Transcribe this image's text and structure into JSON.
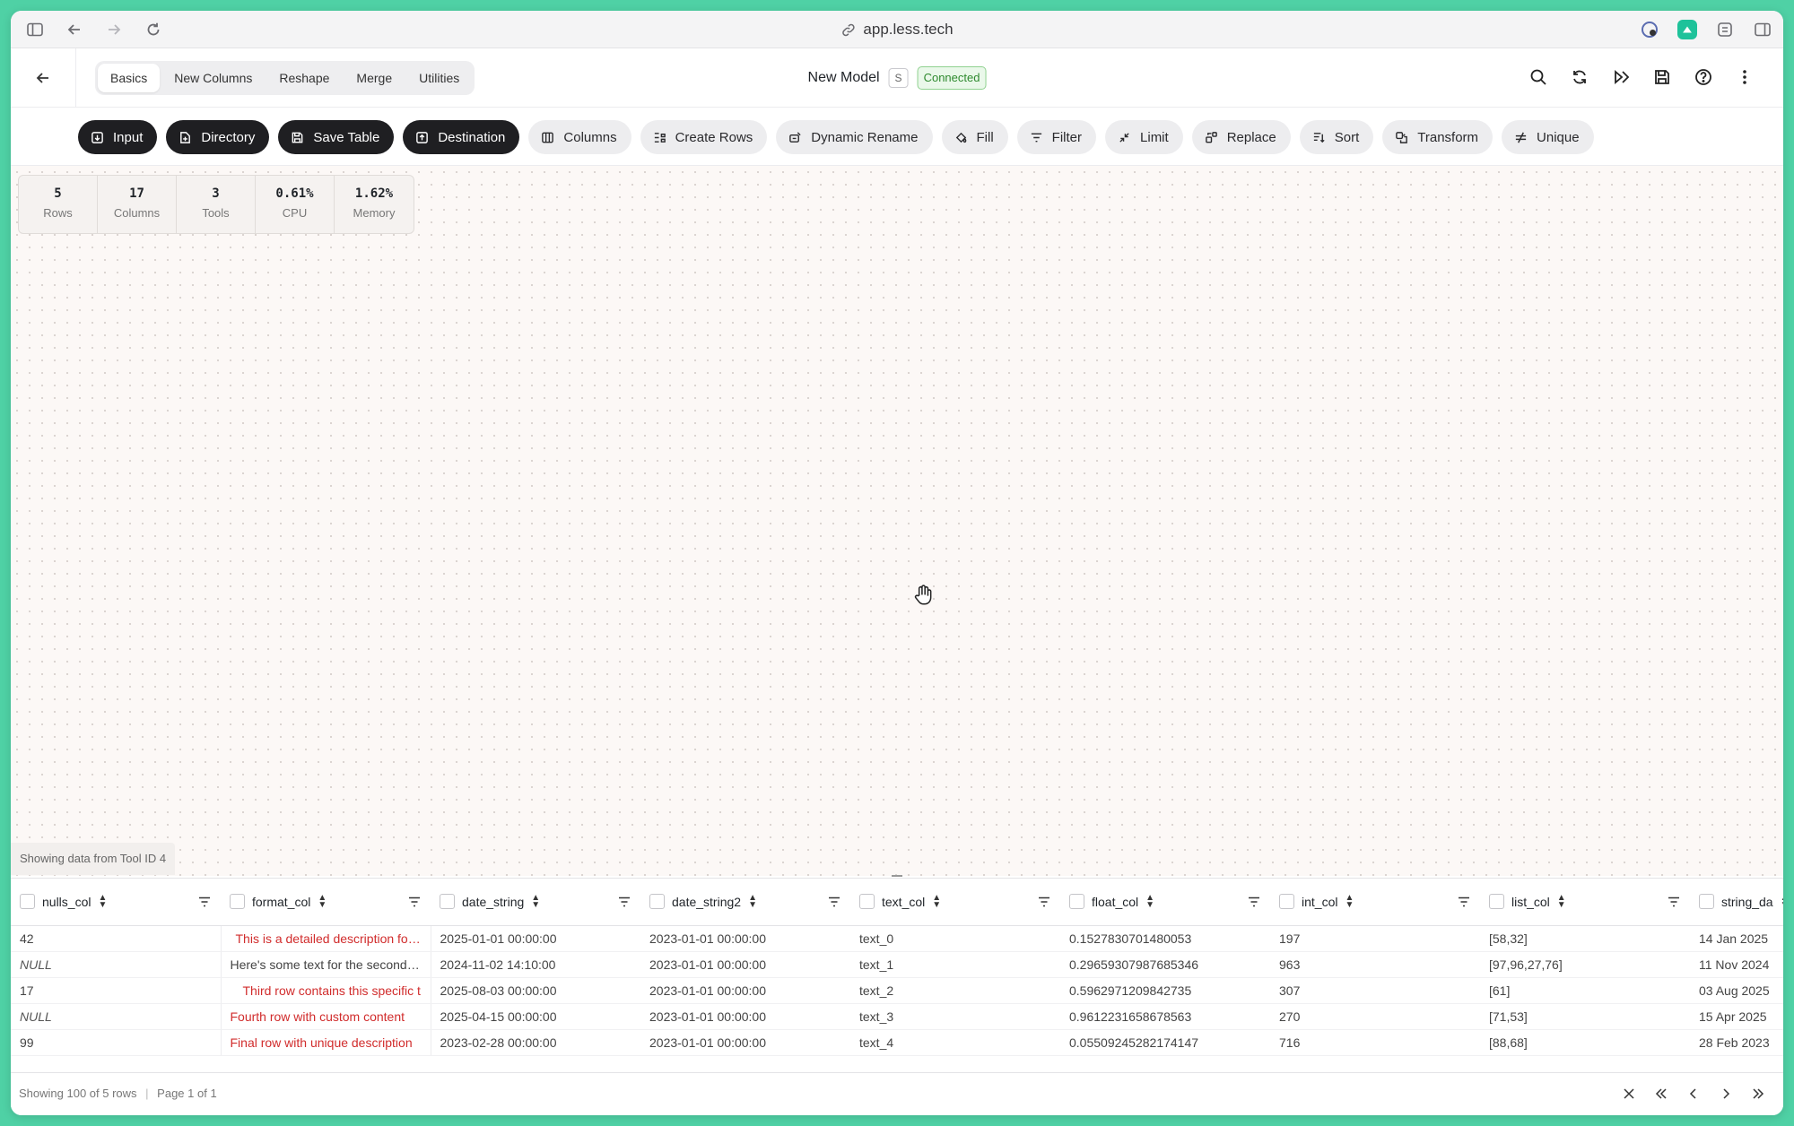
{
  "browser": {
    "url": "app.less.tech"
  },
  "header": {
    "tabs": [
      "Basics",
      "New Columns",
      "Reshape",
      "Merge",
      "Utilities"
    ],
    "model_name": "New Model",
    "model_badge": "S",
    "status": "Connected"
  },
  "toolbar": {
    "tools": [
      {
        "label": "Input",
        "icon": "input-icon",
        "style": "dark"
      },
      {
        "label": "Directory",
        "icon": "directory-icon",
        "style": "dark"
      },
      {
        "label": "Save Table",
        "icon": "save-icon",
        "style": "dark"
      },
      {
        "label": "Destination",
        "icon": "destination-icon",
        "style": "dark"
      },
      {
        "label": "Columns",
        "icon": "columns-icon",
        "style": "light"
      },
      {
        "label": "Create Rows",
        "icon": "create-rows-icon",
        "style": "light"
      },
      {
        "label": "Dynamic Rename",
        "icon": "rename-icon",
        "style": "light"
      },
      {
        "label": "Fill",
        "icon": "fill-icon",
        "style": "light"
      },
      {
        "label": "Filter",
        "icon": "filter-icon",
        "style": "light"
      },
      {
        "label": "Limit",
        "icon": "limit-icon",
        "style": "light"
      },
      {
        "label": "Replace",
        "icon": "replace-icon",
        "style": "light"
      },
      {
        "label": "Sort",
        "icon": "sort-icon",
        "style": "light"
      },
      {
        "label": "Transform",
        "icon": "transform-icon",
        "style": "light"
      },
      {
        "label": "Unique",
        "icon": "unique-icon",
        "style": "light"
      }
    ]
  },
  "stats": [
    {
      "value": "5",
      "label": "Rows"
    },
    {
      "value": "17",
      "label": "Columns"
    },
    {
      "value": "3",
      "label": "Tools"
    },
    {
      "value": "0.61%",
      "label": "CPU"
    },
    {
      "value": "1.62%",
      "label": "Memory"
    }
  ],
  "source_label": "Showing data from Tool ID 4",
  "table": {
    "columns": [
      "nulls_col",
      "format_col",
      "date_string",
      "date_string2",
      "text_col",
      "float_col",
      "int_col",
      "list_col",
      "string_da"
    ],
    "rows": [
      [
        "42",
        "This is a detailed description for ro",
        "2025-01-01 00:00:00",
        "2023-01-01 00:00:00",
        "text_0",
        "0.1527830701480053",
        "197",
        "[58,32]",
        "14 Jan 2025"
      ],
      [
        "NULL",
        "Here's some text for the second r...",
        "2024-11-02 14:10:00",
        "2023-01-01 00:00:00",
        "text_1",
        "0.29659307987685346",
        "963",
        "[97,96,27,76]",
        "11 Nov 2024"
      ],
      [
        "17",
        "Third row contains this specific t",
        "2025-08-03 00:00:00",
        "2023-01-01 00:00:00",
        "text_2",
        "0.5962971209842735",
        "307",
        "[61]",
        "03 Aug 2025"
      ],
      [
        "NULL",
        "Fourth row with custom content",
        "2025-04-15 00:00:00",
        "2023-01-01 00:00:00",
        "text_3",
        "0.9612231658678563",
        "270",
        "[71,53]",
        "15 Apr 2025"
      ],
      [
        "99",
        "Final row with unique description",
        "2023-02-28 00:00:00",
        "2023-01-01 00:00:00",
        "text_4",
        "0.05509245282174147",
        "716",
        "[88,68]",
        "28 Feb 2023"
      ]
    ]
  },
  "footer": {
    "summary": "Showing 100 of 5 rows",
    "separator": "|",
    "page": "Page 1 of 1"
  },
  "colors": {
    "accent_dark": "#1f1f22",
    "connected": "#2f8a2f",
    "format_text": "#d12c2c"
  }
}
